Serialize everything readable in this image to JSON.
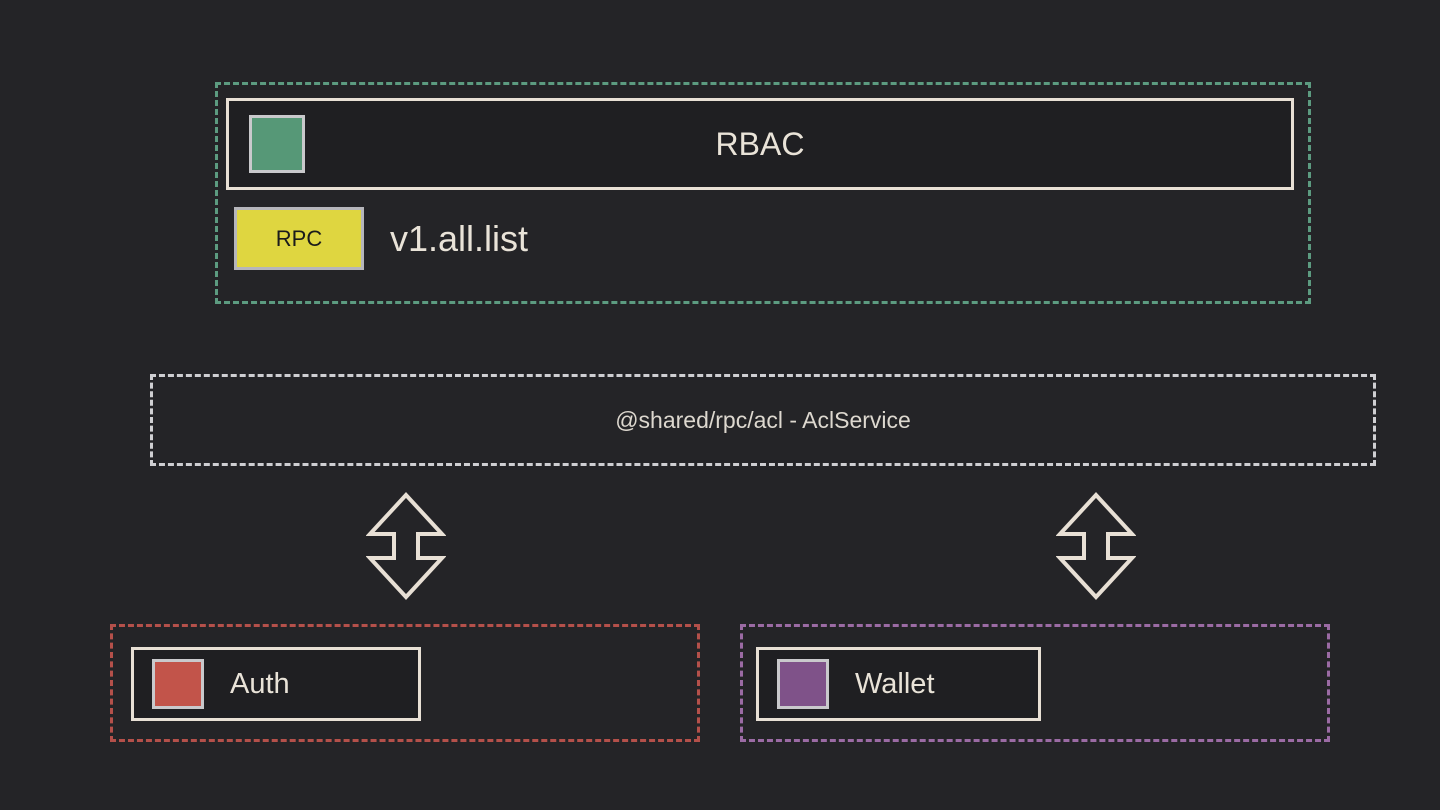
{
  "diagram": {
    "background_color": "#242427",
    "rbac": {
      "group_border_color": "#5c9b80",
      "title": "RBAC",
      "swatch_color": "#569877",
      "swatch_name": "rbac-color-swatch",
      "rpc_badge_label": "RPC",
      "rpc_badge_color": "#dfd640",
      "rpc_method": "v1.all.list"
    },
    "shared": {
      "label": "@shared/rpc/acl - AclService",
      "group_border_color": "#cfcfd2"
    },
    "arrows": [
      {
        "name": "bidirectional-arrow-auth",
        "direction": "up-down",
        "stroke_color": "#e8e0d5"
      },
      {
        "name": "bidirectional-arrow-wallet",
        "direction": "up-down",
        "stroke_color": "#e8e0d5"
      }
    ],
    "services": [
      {
        "name": "auth",
        "label": "Auth",
        "swatch_color": "#c2544a",
        "group_border_color": "#b4504a"
      },
      {
        "name": "wallet",
        "label": "Wallet",
        "swatch_color": "#7f5289",
        "group_border_color": "#9b6ba4"
      }
    ]
  }
}
